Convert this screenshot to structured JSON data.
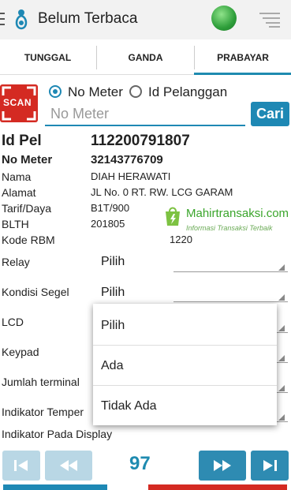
{
  "app": {
    "title": "Belum Terbaca"
  },
  "tabs": [
    "TUNGGAL",
    "GANDA",
    "PRABAYAR"
  ],
  "search": {
    "scan_label": "SCAN",
    "radio_options": [
      "No Meter",
      "Id Pelanggan"
    ],
    "selected": "No Meter",
    "placeholder": "No Meter",
    "button": "Cari"
  },
  "info": {
    "id_pel": {
      "label": "Id Pel",
      "value": "112200791807"
    },
    "no_meter": {
      "label": "No Meter",
      "value": "32143776709"
    },
    "rows": [
      {
        "label": "Nama",
        "value": "DIAH HERAWATI"
      },
      {
        "label": "Alamat",
        "value": "JL No. 0  RT. RW.  LCG GARAM"
      },
      {
        "label": "Tarif/Daya",
        "value": "B1T/900"
      },
      {
        "label": "BLTH",
        "value": "201805"
      },
      {
        "label": "Kode RBM",
        "value": "1220"
      }
    ]
  },
  "fields": [
    {
      "label": "Relay",
      "value": "Pilih"
    },
    {
      "label": "Kondisi Segel",
      "value": "Pilih"
    },
    {
      "label": "LCD",
      "value": ""
    },
    {
      "label": "Keypad",
      "value": ""
    },
    {
      "label": "Jumlah terminal",
      "value": ""
    },
    {
      "label": "Indikator Temper",
      "value": ""
    },
    {
      "label": "Indikator Pada Display",
      "value": ""
    }
  ],
  "dropdown": {
    "options": [
      "Pilih",
      "Ada",
      "Tidak Ada"
    ]
  },
  "watermark": {
    "name": "Mahirtransaksi.com",
    "tagline": "Informasi Transaksi Terbaik"
  },
  "pager": {
    "page": "97"
  },
  "colors": {
    "accent": "#1e88b4",
    "scan": "#d42a22",
    "brand_green": "#3aa52b"
  },
  "icons": [
    "hamburger-icon",
    "app-logo-icon",
    "globe-icon",
    "menu-lines-icon",
    "scan-icon",
    "first-icon",
    "rewind-icon",
    "fast-forward-icon",
    "last-icon"
  ]
}
